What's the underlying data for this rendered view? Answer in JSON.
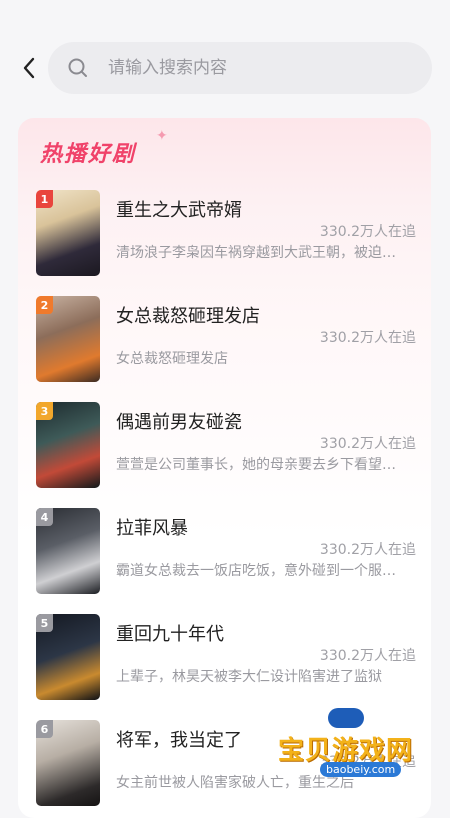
{
  "header": {
    "search": {
      "placeholder": "请输入搜索内容",
      "value": ""
    },
    "icons": {
      "back": "chevron-left-icon",
      "search": "search-icon"
    }
  },
  "section": {
    "title": "热播好剧",
    "accent_color": "#f0436a"
  },
  "items": [
    {
      "rank": "1",
      "title": "重生之大武帝婿",
      "count": "330.2万人在追",
      "desc": "清场浪子李枭因车祸穿越到大武王朝，被迫入赘陈家",
      "badge_color": "#e9453d"
    },
    {
      "rank": "2",
      "title": "女总裁怒砸理发店",
      "count": "330.2万人在追",
      "desc": "女总裁怒砸理发店",
      "badge_color": "#f07a2c"
    },
    {
      "rank": "3",
      "title": "偶遇前男友碰瓷",
      "count": "330.2万人在追",
      "desc": "萱萱是公司董事长，她的母亲要去乡下看望外婆",
      "badge_color": "#f2a72c"
    },
    {
      "rank": "4",
      "title": "拉菲风暴",
      "count": "330.2万人在追",
      "desc": "霸道女总裁去一饭店吃饭，意外碰到一个服务员",
      "badge_color": "#9a9aa0"
    },
    {
      "rank": "5",
      "title": "重回九十年代",
      "count": "330.2万人在追",
      "desc": "上辈子，林昊天被李大仁设计陷害进了监狱",
      "badge_color": "#9a9aa0"
    },
    {
      "rank": "6",
      "title": "将军，我当定了",
      "count": "330.2万人在追",
      "desc": "女主前世被人陷害家破人亡，重生之后",
      "badge_color": "#9a9aa0"
    }
  ],
  "watermark": {
    "brand": "宝贝游戏网",
    "url": "baobeiy.com"
  }
}
